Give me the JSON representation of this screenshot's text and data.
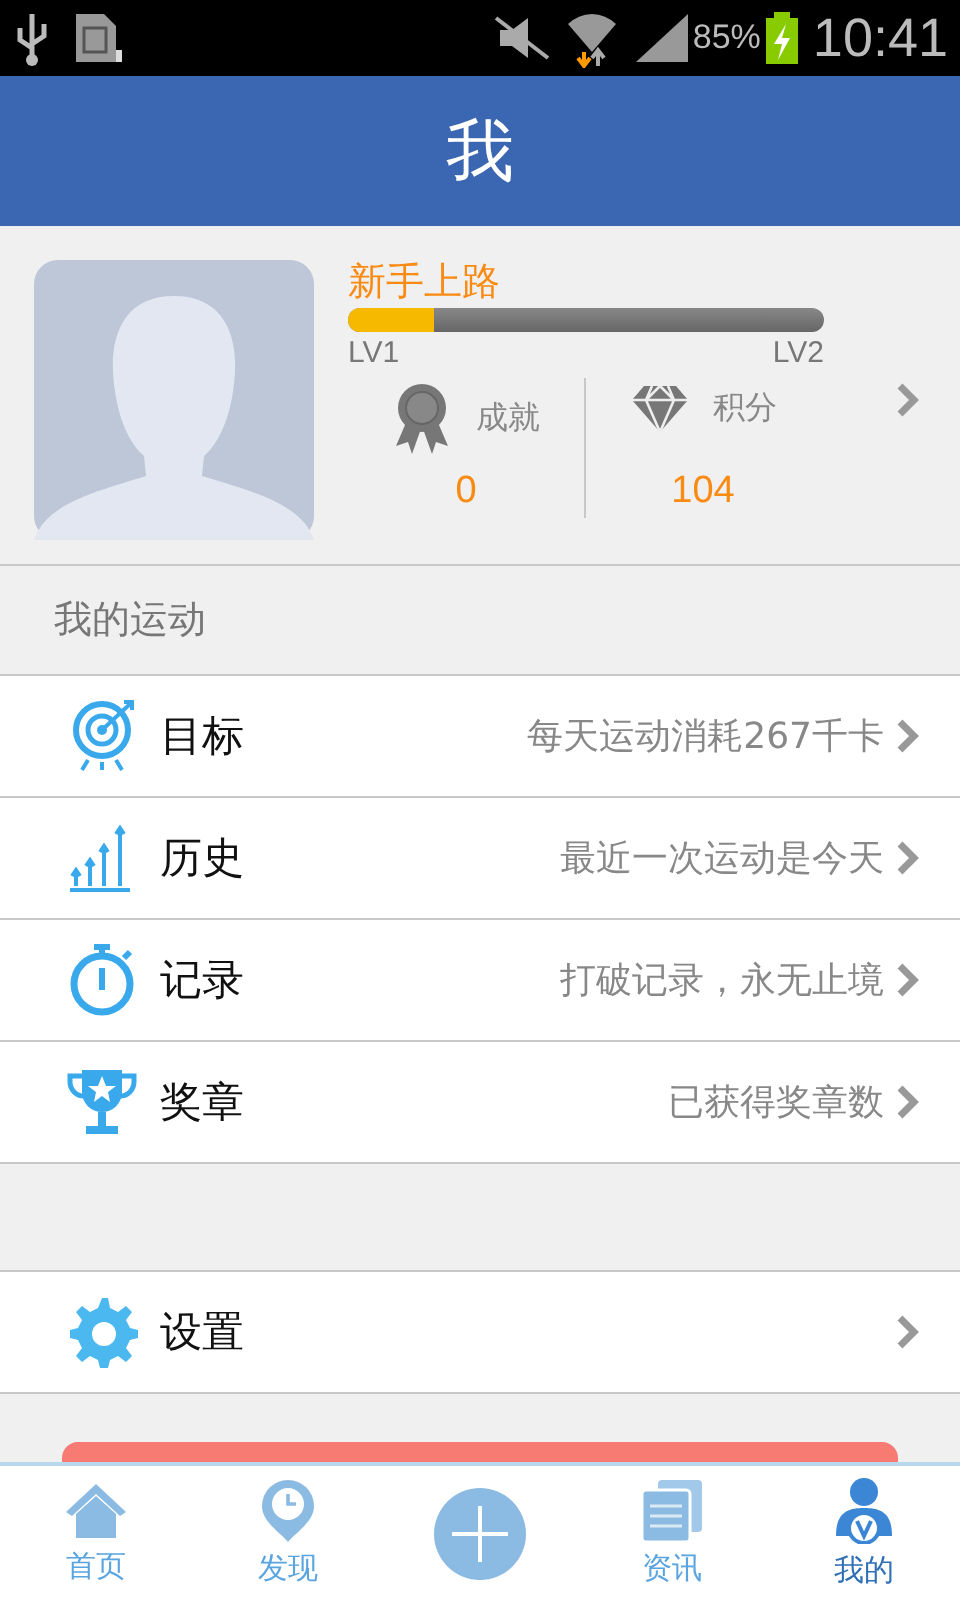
{
  "status_bar": {
    "battery": "85%",
    "time": "10:41"
  },
  "header": {
    "title": "我"
  },
  "profile": {
    "rank": "新手上路",
    "level": 0.18,
    "level_from": "LV1",
    "level_to": "LV2",
    "stats": [
      {
        "kind": "medal",
        "label": "成就",
        "value": "0"
      },
      {
        "kind": "diamond",
        "label": "积分",
        "value": "104"
      }
    ]
  },
  "section": {
    "title": "我的运动"
  },
  "menu": [
    {
      "kind": "target",
      "label": "目标",
      "detail": "每天运动消耗267千卡"
    },
    {
      "kind": "chart",
      "label": "历史",
      "detail": "最近一次运动是今天"
    },
    {
      "kind": "stopwatch",
      "label": "记录",
      "detail": "打破记录，永无止境"
    },
    {
      "kind": "trophy",
      "label": "奖章",
      "detail": "已获得奖章数"
    }
  ],
  "settings": [
    {
      "kind": "gear",
      "label": "设置"
    }
  ],
  "tabs": [
    {
      "kind": "home",
      "label": "首页",
      "selected": false
    },
    {
      "kind": "pin",
      "label": "发现",
      "selected": false
    },
    {
      "kind": "plus",
      "selected": false
    },
    {
      "kind": "news",
      "label": "资讯",
      "selected": false
    },
    {
      "kind": "me",
      "label": "我的",
      "selected": true
    }
  ]
}
